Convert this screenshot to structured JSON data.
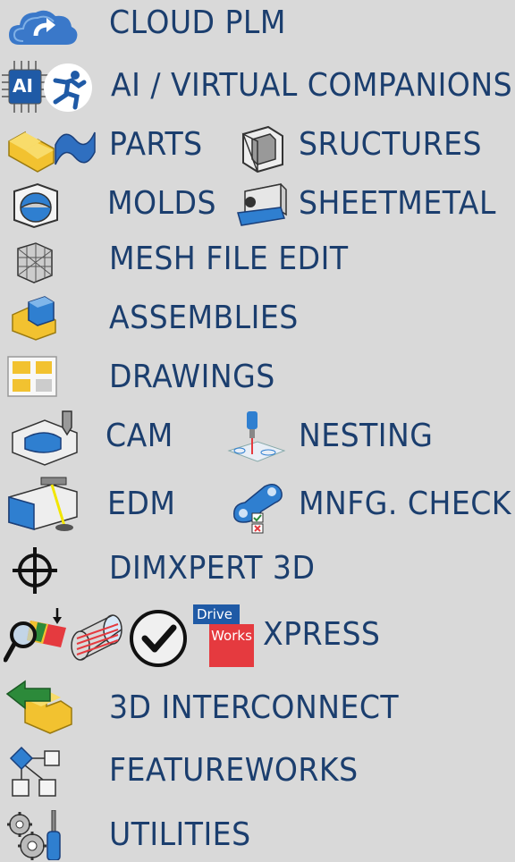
{
  "menu": {
    "cloud_plm": "CLOUD PLM",
    "ai_companions": "AI / VIRTUAL COMPANIONS",
    "parts": "PARTS",
    "structures": "SRUCTURES",
    "molds": "MOLDS",
    "sheetmetal": "SHEETMETAL",
    "mesh_file_edit": "MESH FILE EDIT",
    "assemblies": "ASSEMBLIES",
    "drawings": "DRAWINGS",
    "cam": "CAM",
    "nesting": "NESTING",
    "edm": "EDM",
    "mnfg_check": "MNFG. CHECK",
    "dimxpert": "DIMXPERT 3D",
    "xpress": "XPRESS",
    "interconnect": "3D INTERCONNECT",
    "featureworks": "FEATUREWORKS",
    "utilities": "UTILITIES"
  },
  "ai_chip_text": "AI",
  "driveworks": {
    "top": "Drive",
    "bottom": "Works"
  },
  "colors": {
    "background": "#d9d9d9",
    "label_text": "#1b3e6e",
    "cloud": "#3a78c9",
    "chip": "#1f5aa6",
    "part_yellow": "#f2c230",
    "drive_blue": "#1f5aa6",
    "works_red": "#e53a3f",
    "arrow_green": "#2c8a3a"
  }
}
